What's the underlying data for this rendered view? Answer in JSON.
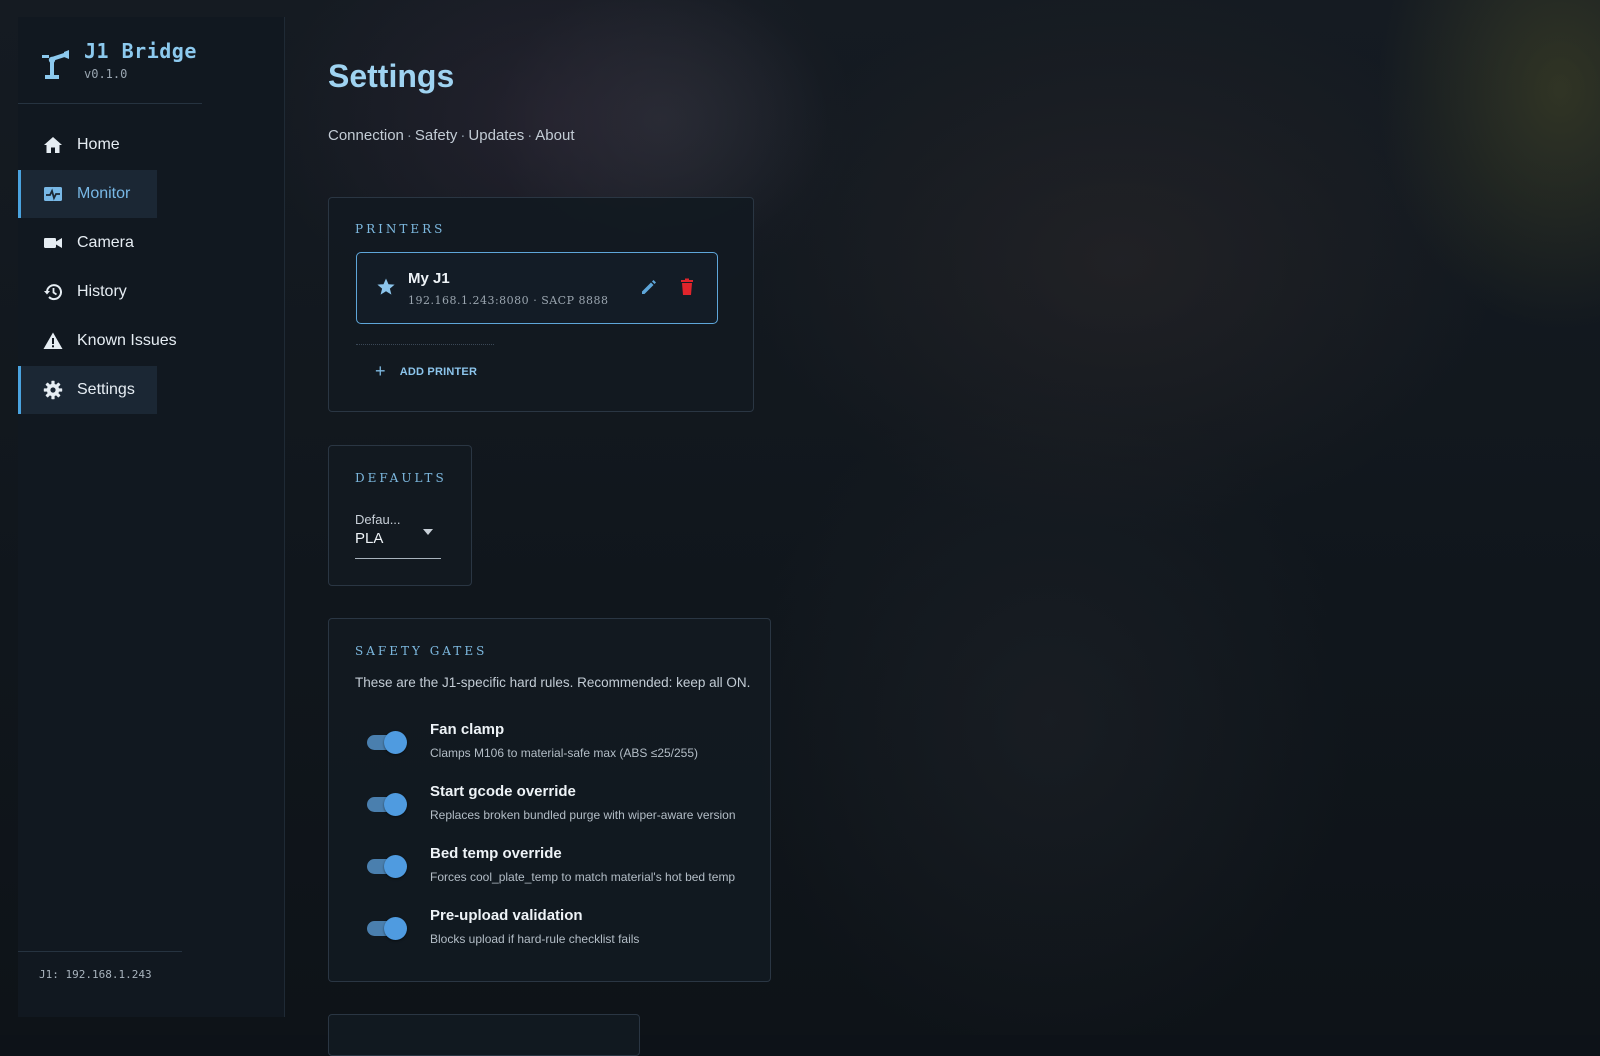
{
  "app": {
    "name": "J1 Bridge",
    "version": "v0.1.0",
    "accent_color": "#4aa3df"
  },
  "sidebar": {
    "items": [
      {
        "label": "Home",
        "icon": "home-icon",
        "active": false
      },
      {
        "label": "Monitor",
        "icon": "monitor-icon",
        "active": true
      },
      {
        "label": "Camera",
        "icon": "camera-icon",
        "active": false
      },
      {
        "label": "History",
        "icon": "history-icon",
        "active": false
      },
      {
        "label": "Known Issues",
        "icon": "warning-icon",
        "active": false
      },
      {
        "label": "Settings",
        "icon": "gear-icon",
        "active": true
      }
    ],
    "footer": "J1: 192.168.1.243"
  },
  "page": {
    "title": "Settings",
    "breadcrumb": [
      "Connection",
      "Safety",
      "Updates",
      "About"
    ],
    "breadcrumb_separator": "·"
  },
  "printers": {
    "label": "PRINTERS",
    "items": [
      {
        "name": "My J1",
        "address": "192.168.1.243:8080",
        "separator": "·",
        "sacp": "SACP 8888",
        "default": true
      }
    ],
    "add_label": "ADD PRINTER"
  },
  "defaults": {
    "label": "DEFAULTS",
    "field_label": "Defau...",
    "field_value": "PLA"
  },
  "safety": {
    "label": "SAFETY GATES",
    "description": "These are the J1-specific hard rules. Recommended: keep all ON.",
    "gates": [
      {
        "title": "Fan clamp",
        "desc": "Clamps M106 to material-safe max (ABS ≤25/255)",
        "enabled": true
      },
      {
        "title": "Start gcode override",
        "desc": "Replaces broken bundled purge with wiper-aware version",
        "enabled": true
      },
      {
        "title": "Bed temp override",
        "desc": "Forces cool_plate_temp to match material's hot bed temp",
        "enabled": true
      },
      {
        "title": "Pre-upload validation",
        "desc": "Blocks upload if hard-rule checklist fails",
        "enabled": true
      }
    ]
  }
}
